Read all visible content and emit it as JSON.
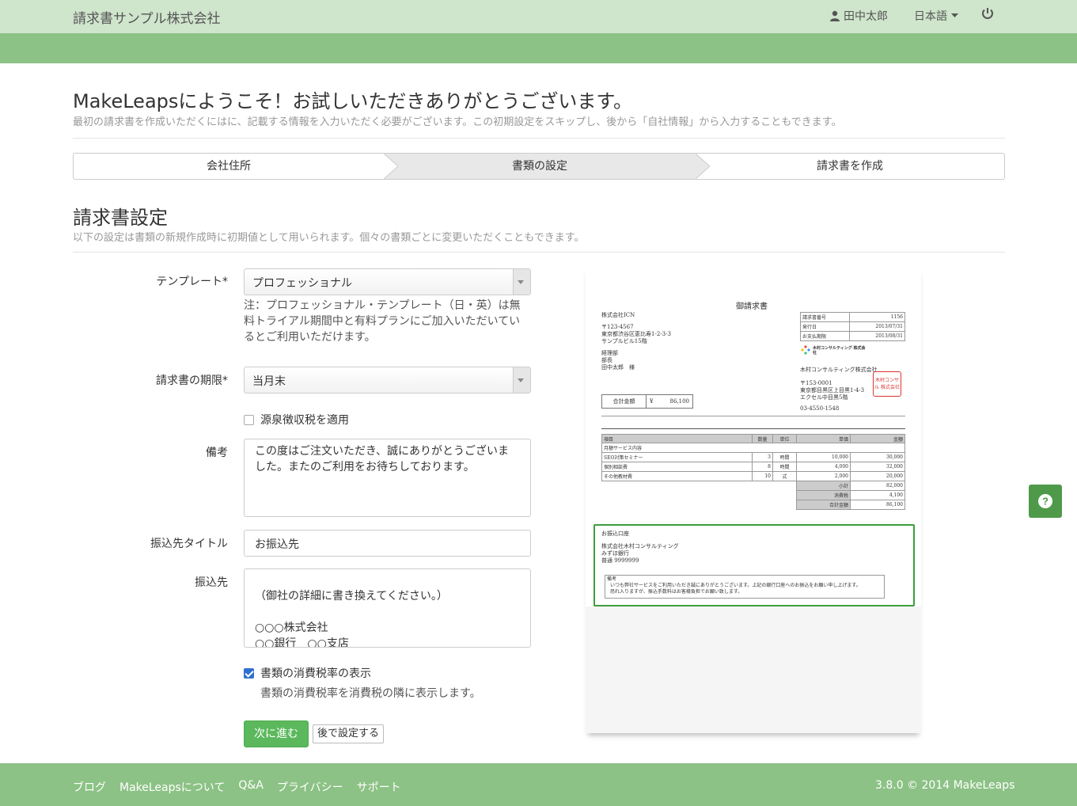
{
  "header": {
    "company": "請求書サンプル株式会社",
    "user": "田中太郎",
    "language": "日本語"
  },
  "welcome": {
    "title": "MakeLeapsにようこそ！お試しいただきありがとうございます。",
    "subtitle": "最初の請求書を作成いただくにはに、記載する情報を入力いただく必要がございます。この初期設定をスキップし、後から「自社情報」から入力することもできます。"
  },
  "steps": [
    "会社住所",
    "書類の設定",
    "請求書を作成"
  ],
  "section": {
    "title": "請求書設定",
    "subtitle": "以下の設定は書類の新規作成時に初期値として用いられます。個々の書類ごとに変更いただくこともできます。"
  },
  "form": {
    "template_label": "テンプレート*",
    "template_value": "プロフェッショナル",
    "template_note": "注：プロフェッショナル・テンプレート（日・英）は無料トライアル期間中と有料プランにご加入いただいているとご利用いただけます。",
    "due_label": "請求書の期限*",
    "due_value": "当月末",
    "withholding_label": "源泉徴収税を適用",
    "remarks_label": "備考",
    "remarks_value": "この度はご注文いただき、誠にありがとうございました。またのご利用をお待ちしております。",
    "transfer_title_label": "振込先タイトル",
    "transfer_title_value": "お振込先",
    "transfer_label": "振込先",
    "transfer_value": "\n（御社の詳細に書き換えてください。）\n\n○○○株式会社\n○○銀行　○○支店",
    "tax_rate_label": "書類の消費税率の表示",
    "tax_rate_help": "書類の消費税率を消費税の隣に表示します。",
    "next_button": "次に進む",
    "later_button": "後で設定する"
  },
  "preview": {
    "doc_title": "御請求書",
    "client_lines": [
      "株式会社ICN",
      "",
      "〒123-4567",
      "東京都渋谷区恵比寿1-2-3-3",
      "サンプルビル15階",
      "",
      "経理部",
      "部長",
      "田中太郎　様"
    ],
    "meta": [
      {
        "k": "請求書番号",
        "v": "1156"
      },
      {
        "k": "発行日",
        "v": "2013/07/31"
      },
      {
        "k": "お支払期限",
        "v": "2013/08/31"
      }
    ],
    "vendor_logo_text": "木村コンサルティング 株式会社",
    "vendor_lines": [
      "木村コンサルティング株式会社",
      "",
      "",
      "〒153-0001",
      "東京都目黒区上目黒1-4-3",
      "エクセル中目黒5階",
      "",
      "03-4550-1548"
    ],
    "stamp": "木村コンサル 株式会社",
    "total_label": "合計金額",
    "total_currency": "¥",
    "total_value": "86,100",
    "item_headers": [
      "項目",
      "数量",
      "単位",
      "単価",
      "金額"
    ],
    "item_group": "月額サービス内容",
    "items": [
      {
        "name": "SEO対策セミナー",
        "qty": "3",
        "unit": "時間",
        "price": "10,000",
        "amount": "30,000"
      },
      {
        "name": "個別相談費",
        "qty": "8",
        "unit": "時間",
        "price": "4,000",
        "amount": "32,000"
      },
      {
        "name": "その他教材費",
        "qty": "10",
        "unit": "式",
        "price": "2,000",
        "amount": "20,000"
      }
    ],
    "subtotals": [
      {
        "k": "小計",
        "v": "82,000"
      },
      {
        "k": "消費税",
        "v": "4,100"
      },
      {
        "k": "合計金額",
        "v": "86,100"
      }
    ],
    "bank_title": "お振込口座",
    "bank_lines": [
      "株式会社木村コンサルティング",
      "みずほ銀行",
      "普通 9999999"
    ],
    "note_title": "備考",
    "note_lines": [
      "いつも弊社サービスをご利用いただき誠にありがとうございます。上記の銀行口座へのお振込をお願い申し上げます。",
      "恐れ入りますが、振込手数料はお客様負担でお願い致します。"
    ]
  },
  "footer": {
    "links": [
      "ブログ",
      "MakeLeapsについて",
      "Q&A",
      "プライバシー",
      "サポート"
    ],
    "copyright": "3.8.0 © 2014 MakeLeaps"
  },
  "colors": {
    "topbar": "#cfe5cc",
    "brand_green": "#8cc285",
    "primary_button": "#5cb85c",
    "help_button": "#4e9a4a"
  }
}
